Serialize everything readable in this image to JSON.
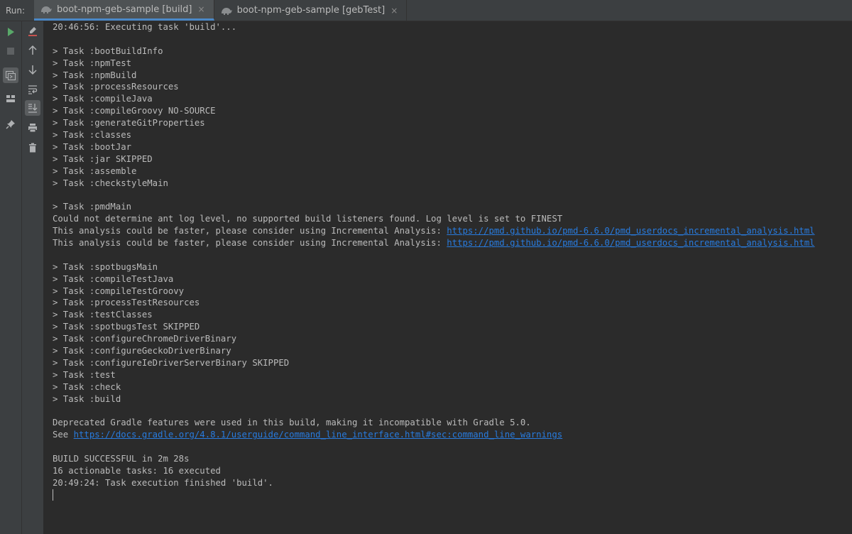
{
  "run_label": "Run:",
  "tabs": [
    {
      "label": "boot-npm-geb-sample [build]",
      "active": true
    },
    {
      "label": "boot-npm-geb-sample [gebTest]",
      "active": false
    }
  ],
  "tab_close_glyph": "×",
  "toolbar_icons": {
    "left": [
      "run-icon",
      "stop-icon",
      "console-icon",
      "layout-icon",
      "pin-icon"
    ],
    "right": [
      "clear-icon",
      "arrow-up-icon",
      "arrow-down-icon",
      "soft-wrap-icon",
      "scroll-to-end-icon",
      "print-icon",
      "trash-icon"
    ]
  },
  "colors": {
    "run_green": "#59a869",
    "link_blue": "#287bde",
    "text": "#bbbbbb",
    "clear_red": "#c75450"
  },
  "console": {
    "lines": [
      {
        "text": "20:46:56: Executing task 'build'..."
      },
      {
        "text": ""
      },
      {
        "text": "> Task :bootBuildInfo"
      },
      {
        "text": "> Task :npmTest"
      },
      {
        "text": "> Task :npmBuild"
      },
      {
        "text": "> Task :processResources"
      },
      {
        "text": "> Task :compileJava"
      },
      {
        "text": "> Task :compileGroovy NO-SOURCE"
      },
      {
        "text": "> Task :generateGitProperties"
      },
      {
        "text": "> Task :classes"
      },
      {
        "text": "> Task :bootJar"
      },
      {
        "text": "> Task :jar SKIPPED"
      },
      {
        "text": "> Task :assemble"
      },
      {
        "text": "> Task :checkstyleMain"
      },
      {
        "text": ""
      },
      {
        "text": "> Task :pmdMain"
      },
      {
        "text": "Could not determine ant log level, no supported build listeners found. Log level is set to FINEST"
      },
      {
        "text": "This analysis could be faster, please consider using Incremental Analysis: ",
        "link": "https://pmd.github.io/pmd-6.6.0/pmd_userdocs_incremental_analysis.html"
      },
      {
        "text": "This analysis could be faster, please consider using Incremental Analysis: ",
        "link": "https://pmd.github.io/pmd-6.6.0/pmd_userdocs_incremental_analysis.html"
      },
      {
        "text": ""
      },
      {
        "text": "> Task :spotbugsMain"
      },
      {
        "text": "> Task :compileTestJava"
      },
      {
        "text": "> Task :compileTestGroovy"
      },
      {
        "text": "> Task :processTestResources"
      },
      {
        "text": "> Task :testClasses"
      },
      {
        "text": "> Task :spotbugsTest SKIPPED"
      },
      {
        "text": "> Task :configureChromeDriverBinary"
      },
      {
        "text": "> Task :configureGeckoDriverBinary"
      },
      {
        "text": "> Task :configureIeDriverServerBinary SKIPPED"
      },
      {
        "text": "> Task :test"
      },
      {
        "text": "> Task :check"
      },
      {
        "text": "> Task :build"
      },
      {
        "text": ""
      },
      {
        "text": "Deprecated Gradle features were used in this build, making it incompatible with Gradle 5.0."
      },
      {
        "text": "See ",
        "link": "https://docs.gradle.org/4.8.1/userguide/command_line_interface.html#sec:command_line_warnings"
      },
      {
        "text": ""
      },
      {
        "text": "BUILD SUCCESSFUL in 2m 28s"
      },
      {
        "text": "16 actionable tasks: 16 executed"
      },
      {
        "text": "20:49:24: Task execution finished 'build'."
      }
    ]
  }
}
